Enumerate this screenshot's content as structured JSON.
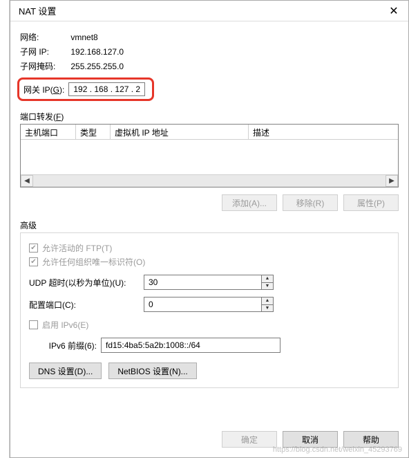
{
  "title": "NAT 设置",
  "info": {
    "network_label": "网络:",
    "network_value": "vmnet8",
    "subnet_ip_label": "子网 IP:",
    "subnet_ip_value": "192.168.127.0",
    "subnet_mask_label": "子网掩码:",
    "subnet_mask_value": "255.255.255.0",
    "gateway_label_pre": "网关 IP(",
    "gateway_label_key": "G",
    "gateway_label_post": "):",
    "gateway_value": "192 . 168 . 127 .   2"
  },
  "port_forward": {
    "label_pre": "端口转发(",
    "label_key": "F",
    "label_post": ")",
    "cols": {
      "host_port": "主机端口",
      "type": "类型",
      "vm_ip": "虚拟机 IP 地址",
      "desc": "描述"
    },
    "add_btn": "添加(A)...",
    "remove_btn": "移除(R)",
    "props_btn": "属性(P)"
  },
  "adv": {
    "group_label": "高级",
    "allow_active_ftp": "允许活动的 FTP(T)",
    "allow_any_oui": "允许任何组织唯一标识符(O)",
    "udp_timeout_label": "UDP 超时(以秒为单位)(U):",
    "udp_timeout_value": "30",
    "config_port_label": "配置端口(C):",
    "config_port_value": "0",
    "enable_ipv6": "启用 IPv6(E)",
    "ipv6_prefix_label": "IPv6 前缀(6):",
    "ipv6_prefix_value": "fd15:4ba5:5a2b:1008::/64",
    "dns_btn": "DNS 设置(D)...",
    "netbios_btn": "NetBIOS 设置(N)..."
  },
  "footer": {
    "ok": "确定",
    "cancel": "取消",
    "help": "帮助"
  },
  "watermark": "https://blog.csdn.net/weixin_45293769"
}
